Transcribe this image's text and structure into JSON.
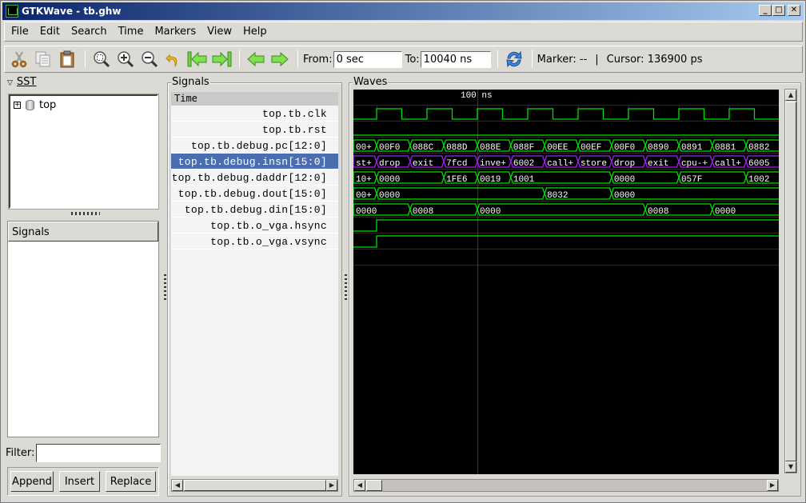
{
  "window": {
    "title": "GTKWave - tb.ghw",
    "controls": [
      "minimize",
      "maximize",
      "close"
    ]
  },
  "menu": [
    "File",
    "Edit",
    "Search",
    "Time",
    "Markers",
    "View",
    "Help"
  ],
  "toolbar": {
    "icons": [
      "cut-icon",
      "copy-icon",
      "paste-icon",
      "zoom-fit-icon",
      "zoom-in-icon",
      "zoom-out-icon",
      "undo-zoom-icon",
      "jump-start-icon",
      "jump-end-icon",
      "prev-edge-icon",
      "next-edge-icon",
      "reload-icon"
    ],
    "from_label": "From:",
    "from_value": "0 sec",
    "to_label": "To:",
    "to_value": "10040 ns",
    "marker_text": "Marker: --",
    "separator": "|",
    "cursor_text": "Cursor: 136900 ps"
  },
  "sst": {
    "label": "SST",
    "tree": [
      {
        "name": "top",
        "expandable": true
      }
    ],
    "signals_header": "Signals",
    "filter_label": "Filter:",
    "filter_value": "",
    "buttons": [
      "Append",
      "Insert",
      "Replace"
    ]
  },
  "signals_panel": {
    "label": "Signals",
    "header": "Time",
    "rows": [
      {
        "name": "top.tb.clk",
        "selected": false
      },
      {
        "name": "top.tb.rst",
        "selected": false
      },
      {
        "name": "top.tb.debug.pc[12:0]",
        "selected": false
      },
      {
        "name": "top.tb.debug.insn[15:0]",
        "selected": true
      },
      {
        "name": "top.tb.debug.daddr[12:0]",
        "selected": false
      },
      {
        "name": "top.tb.debug.dout[15:0]",
        "selected": false
      },
      {
        "name": "top.tb.debug.din[15:0]",
        "selected": false
      },
      {
        "name": "top.tb.o_vga.hsync",
        "selected": false
      },
      {
        "name": "top.tb.o_vga.vsync",
        "selected": false
      }
    ]
  },
  "waves": {
    "label": "Waves",
    "ruler_label": "100 ns",
    "ruler_time_ns": 100,
    "view_start_ns": 50.8,
    "view_end_ns": 219.7,
    "cursor_ns": 100,
    "colors": {
      "background": "#000000",
      "trace": "#00e000",
      "bus_highlight": "#a020f0",
      "grid": "#20206a",
      "cursor": "#3030a0",
      "text": "#ffffff"
    },
    "clk": {
      "period_ns": 20,
      "rising_edges_ns": [
        60.0,
        80.0,
        100.0,
        120.0,
        140.0,
        160.0,
        180.0,
        200.0
      ]
    },
    "rst": {
      "level": 0
    },
    "buses": [
      {
        "signal": "pc",
        "highlight": false,
        "segments": [
          {
            "start": 50.8,
            "value": "00+"
          },
          {
            "start": 60,
            "value": "00F0"
          },
          {
            "start": 73.3,
            "value": "088C"
          },
          {
            "start": 86.7,
            "value": "088D"
          },
          {
            "start": 100,
            "value": "088E"
          },
          {
            "start": 113.3,
            "value": "088F"
          },
          {
            "start": 126.7,
            "value": "00EE"
          },
          {
            "start": 140,
            "value": "00EF"
          },
          {
            "start": 153.3,
            "value": "00F0"
          },
          {
            "start": 166.7,
            "value": "0890"
          },
          {
            "start": 180,
            "value": "0891"
          },
          {
            "start": 193.3,
            "value": "0881"
          },
          {
            "start": 206.7,
            "value": "0882"
          }
        ]
      },
      {
        "signal": "insn",
        "highlight": true,
        "segments": [
          {
            "start": 50.8,
            "value": "st+"
          },
          {
            "start": 60,
            "value": "drop"
          },
          {
            "start": 73.3,
            "value": "exit"
          },
          {
            "start": 86.7,
            "value": "7fcd"
          },
          {
            "start": 100,
            "value": "inve+"
          },
          {
            "start": 113.3,
            "value": "6002"
          },
          {
            "start": 126.7,
            "value": "call+"
          },
          {
            "start": 140,
            "value": "store"
          },
          {
            "start": 153.3,
            "value": "drop"
          },
          {
            "start": 166.7,
            "value": "exit"
          },
          {
            "start": 180,
            "value": "cpu-+"
          },
          {
            "start": 193.3,
            "value": "call+"
          },
          {
            "start": 206.7,
            "value": "6005"
          }
        ]
      },
      {
        "signal": "daddr",
        "highlight": false,
        "segments": [
          {
            "start": 50.8,
            "value": "10+"
          },
          {
            "start": 60,
            "value": "0000"
          },
          {
            "start": 86.7,
            "value": "1FE6"
          },
          {
            "start": 100,
            "value": "0019"
          },
          {
            "start": 113.3,
            "value": "1001"
          },
          {
            "start": 153.3,
            "value": "0000"
          },
          {
            "start": 180,
            "value": "057F"
          },
          {
            "start": 206.7,
            "value": "1002"
          }
        ]
      },
      {
        "signal": "dout",
        "highlight": false,
        "segments": [
          {
            "start": 50.8,
            "value": "00+"
          },
          {
            "start": 60,
            "value": "0000"
          },
          {
            "start": 126.7,
            "value": "8032"
          },
          {
            "start": 153.3,
            "value": "0000"
          }
        ]
      },
      {
        "signal": "din",
        "highlight": false,
        "segments": [
          {
            "start": 50.8,
            "value": "0000"
          },
          {
            "start": 73.3,
            "value": "0008"
          },
          {
            "start": 100,
            "value": "0000"
          },
          {
            "start": 166.7,
            "value": "0008"
          },
          {
            "start": 193.3,
            "value": "0000"
          }
        ]
      }
    ],
    "hsync": {
      "initial": 0,
      "rise_ns": 60
    },
    "vsync": {
      "initial": 0,
      "rise_ns": 60
    }
  }
}
